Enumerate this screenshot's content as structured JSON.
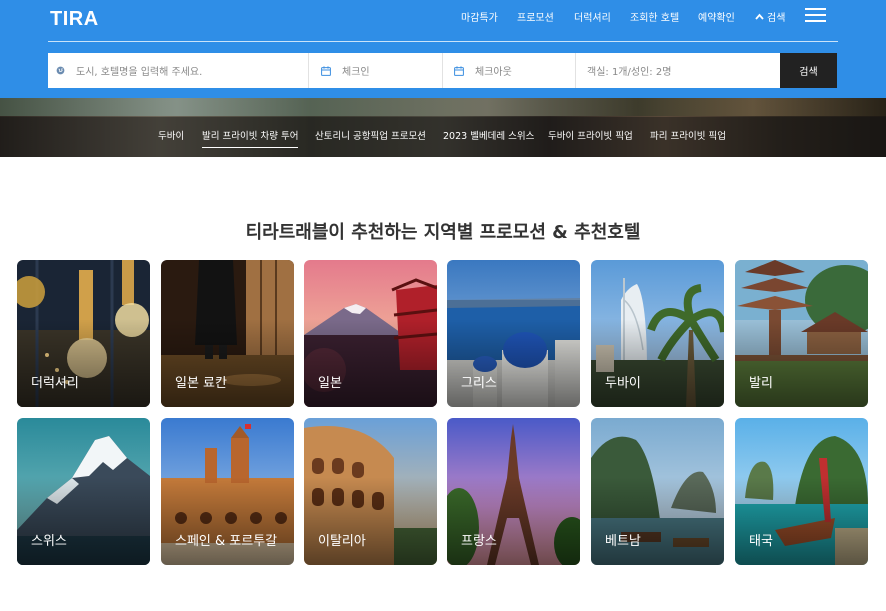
{
  "header": {
    "logo": "TIRA",
    "nav": [
      {
        "label": "마감특가"
      },
      {
        "label": "프로모션"
      },
      {
        "label": "더럭셔리"
      },
      {
        "label": "조회한 호텔"
      },
      {
        "label": "예약확인"
      },
      {
        "label": "검색",
        "icon": "chevron-up-icon"
      }
    ],
    "menu_icon": "hamburger-menu-icon"
  },
  "search": {
    "destination_placeholder": "도시, 호텔명을 입력해 주세요.",
    "checkin": "체크인",
    "checkout": "체크아웃",
    "guests": "객실: 1개/성인: 2명",
    "button": "검색"
  },
  "banner_nav": {
    "items": [
      {
        "label": "두바이",
        "active": false
      },
      {
        "label": "발리 프라이빗 차량 투어",
        "active": true
      },
      {
        "label": "산토리니 공항픽업 프로모션",
        "active": false
      },
      {
        "label": "2023 벨베데레 스위스",
        "active": false
      },
      {
        "label": "두바이 프라이빗 픽업",
        "active": false
      },
      {
        "label": "파리 프라이빗 픽업",
        "active": false
      }
    ]
  },
  "section": {
    "title": "티라트래블이 추천하는 지역별 프로모션 & 추천호텔"
  },
  "regions": [
    {
      "label": "더럭셔리"
    },
    {
      "label": "일본 료칸"
    },
    {
      "label": "일본"
    },
    {
      "label": "그리스"
    },
    {
      "label": "두바이"
    },
    {
      "label": "발리"
    },
    {
      "label": "스위스"
    },
    {
      "label": "스페인 & 포르투갈"
    },
    {
      "label": "이탈리아"
    },
    {
      "label": "프랑스"
    },
    {
      "label": "베트남"
    },
    {
      "label": "태국"
    }
  ],
  "colors": {
    "header_bg": "#2f8ee7",
    "search_button_bg": "#222222",
    "title_text": "#333333"
  }
}
